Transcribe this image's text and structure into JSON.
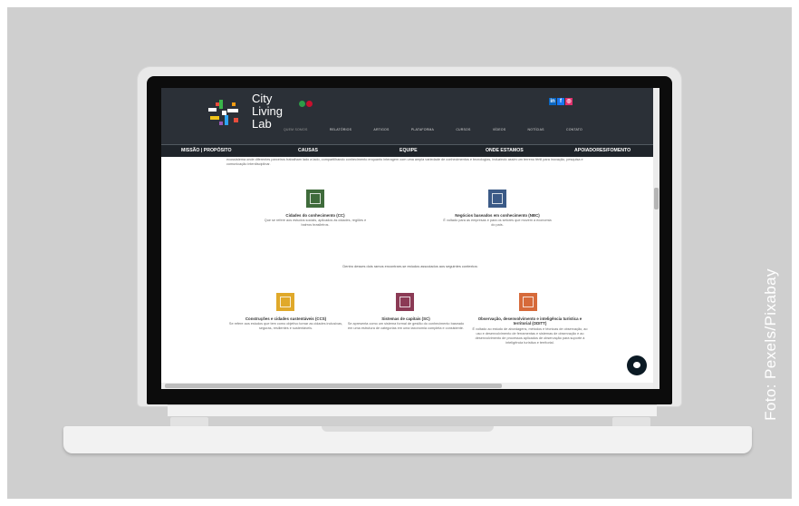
{
  "photo_credit": "Foto: Pexels/Pixabay",
  "site": {
    "logo": {
      "line1": "City",
      "line2": "Living",
      "line3": "Lab"
    },
    "social": [
      {
        "icon": "linkedin-icon",
        "label": "in",
        "color": "#0a66c2"
      },
      {
        "icon": "facebook-icon",
        "label": "f",
        "color": "#1877f2"
      },
      {
        "icon": "instagram-icon",
        "label": "◎",
        "color": "#e1306c"
      }
    ],
    "top_nav": [
      "QUEM SOMOS",
      "RELATÓRIOS",
      "ARTIGOS",
      "PLATAFORMA",
      "CURSOS",
      "VÍDEOS",
      "NOTÍCIAS",
      "CONTATO"
    ],
    "sub_nav": [
      "MISSÃO | PROPÓSITO",
      "CAUSAS",
      "EQUIPE",
      "ONDE ESTAMOS",
      "APOIADORES/FOMENTO"
    ],
    "intro": "ecossistema onde diferentes parceiros trabalham lado a lado, compartilhando conhecimento enquanto interagem com uma ampla variedade de conhecimentos e tecnologias, induzindo assim um terreno fértil para inovação, pesquisa e comunicação interdisciplinar.",
    "categories_top": [
      {
        "title": "Cidades do conhecimento (CC)",
        "desc": "Que se refere aos estudos sociais, aplicados às cidades, regiões e bairros brasileiros.",
        "icon": "city-icon",
        "color": "#3f6b3b"
      },
      {
        "title": "Negócios baseados em conhecimento (NBC)",
        "desc": "É voltado para as empresas e para os setores que movem a economia do país.",
        "icon": "handshake-icon",
        "color": "#3b5a87"
      }
    ],
    "mid_note": "Dentro desses dois ramos encontram-se estudos associados aos seguintes contextos:",
    "categories_bottom": [
      {
        "title": "Construções e cidades sustentáveis (CCS)",
        "desc": "Se refere aos estudos que tem como objetivo tornar as cidades inclusivas, seguras, resilientes e sustentáveis.",
        "icon": "building-icon",
        "color": "#e0a92a"
      },
      {
        "title": "Sistemas de capitais (SC)",
        "desc": "Se apresenta como um sistema formal de gestão do conhecimento baseado em uma estrutura de categorias em uma taxonomia completa e consistente.",
        "icon": "capital-icon",
        "color": "#8b3a55"
      },
      {
        "title": "Observação, desenvolvimento e inteligência turística e territorial (ODITT)",
        "desc": "É voltado ao estudo de abordagens, métodos e técnicas de observação, ao uso e desenvolvimento de ferramentas e sistemas de observação e ao desenvolvimento de processos aplicados de observação para suporte à inteligência turística e territorial.",
        "icon": "observation-icon",
        "color": "#d66a3a"
      }
    ]
  }
}
